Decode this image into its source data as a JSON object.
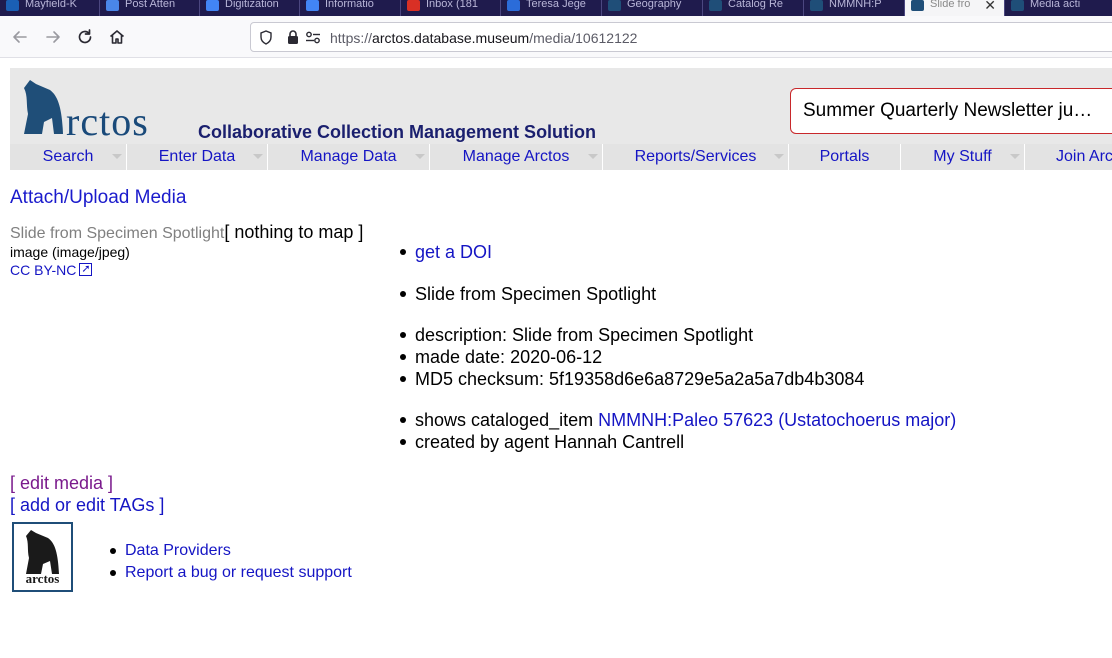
{
  "browser": {
    "tabs": [
      {
        "label": "Mayfield-K",
        "color": "#1a5fb4"
      },
      {
        "label": "Post Atten",
        "color": "#4a86e8"
      },
      {
        "label": "Digitization",
        "color": "#4285f4"
      },
      {
        "label": "Informatio",
        "color": "#4285f4"
      },
      {
        "label": "Inbox (181",
        "color": "#d93025"
      },
      {
        "label": "Teresa Jege",
        "color": "#2b6cd9"
      },
      {
        "label": "Geography",
        "color": "#1f4e78"
      },
      {
        "label": "Catalog Re",
        "color": "#1f4e78"
      },
      {
        "label": "NMMNH:P",
        "color": "#1f4e78"
      },
      {
        "label": "Slide fro",
        "color": "#1f4e78"
      },
      {
        "label": "Media acti",
        "color": "#1f4e78"
      }
    ],
    "url_prefix": "https://",
    "url_host": "arctos.database.museum",
    "url_path": "/media/10612122"
  },
  "site": {
    "logo_text": "rctos",
    "tagline": "Collaborative Collection Management Solution",
    "news": "Summer Quarterly Newsletter ju…",
    "menu": [
      {
        "label": "Search"
      },
      {
        "label": "Enter Data"
      },
      {
        "label": "Manage Data"
      },
      {
        "label": "Manage Arctos"
      },
      {
        "label": "Reports/Services"
      },
      {
        "label": "Portals"
      },
      {
        "label": "My Stuff"
      },
      {
        "label": "Join Arc"
      }
    ]
  },
  "media": {
    "attach_link": "Attach/Upload Media",
    "title": "Slide from Specimen Spotlight",
    "nothing_to_map": "[ nothing to map ]",
    "type": "image (image/jpeg)",
    "license": "CC BY-NC",
    "doi_link": "get a DOI",
    "label": "Slide from Specimen Spotlight",
    "description": "description: Slide from Specimen Spotlight",
    "made_date": "made date: 2020-06-12",
    "checksum": "MD5 checksum: 5f19358d6e6a8729e5a2a5a7db4b3084",
    "shows_prefix": "shows cataloged_item ",
    "shows_link": "NMMNH:Paleo 57623 (Ustatochoerus major)",
    "created_by": "created by agent Hannah Cantrell",
    "edit_media": "[ edit media ]",
    "edit_tags": "[ add or edit TAGs ]"
  },
  "footer": {
    "logo_text": "arctos",
    "links": [
      "Data Providers",
      "Report a bug or request support"
    ]
  }
}
